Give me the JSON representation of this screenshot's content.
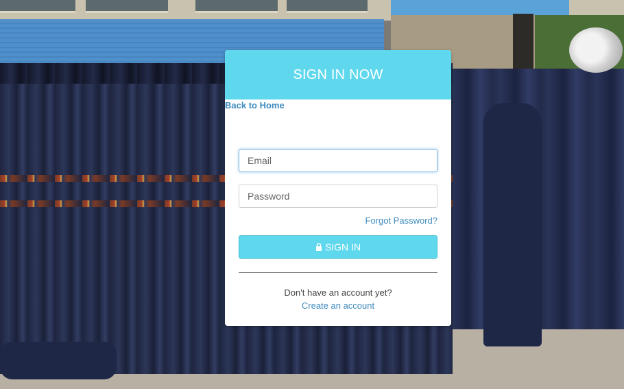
{
  "header": {
    "title": "SIGN IN NOW"
  },
  "nav": {
    "back_label": "Back to Home"
  },
  "form": {
    "email_placeholder": "Email",
    "email_value": "",
    "password_placeholder": "Password",
    "password_value": "",
    "forgot_label": "Forgot Password?",
    "signin_label": "SIGN IN",
    "signin_icon": "lock-icon"
  },
  "footer": {
    "prompt": "Don't have an account yet?",
    "create_label": "Create an account"
  },
  "colors": {
    "accent": "#5fd8ee",
    "link": "#3f8bbf"
  }
}
